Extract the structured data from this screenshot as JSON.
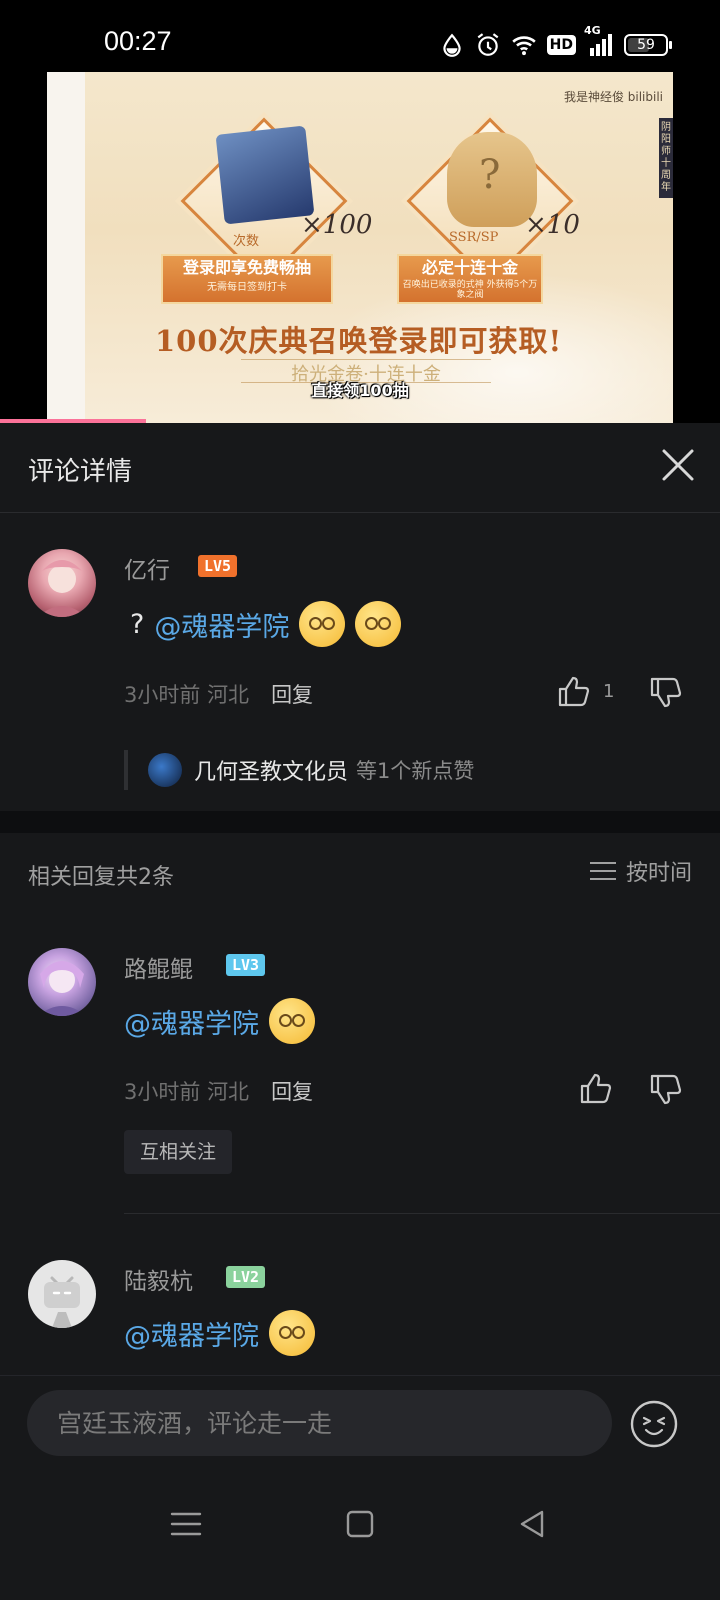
{
  "status_bar": {
    "time": "00:27",
    "hd": "HD",
    "network": "4G",
    "battery": "59",
    "battery_level": 0.59
  },
  "video": {
    "watermark": "我是神经俊 bilibili",
    "item1_label": "次数",
    "item1_multiplier": "×100",
    "item1_title": "登录即享免费畅抽",
    "item1_sub": "无需每日签到打卡",
    "item2_label": "SSR/SP",
    "item2_multiplier": "×10",
    "item2_title": "必定十连十金",
    "item2_sub": "召唤出已收录的式神 外获得5个万象之阀",
    "headline": "100次庆典召唤登录即可获取!",
    "subline": "拾光金卷·十连十金",
    "subtitle": "直接领100抽",
    "side_text": "阴阳师十周年"
  },
  "panel": {
    "title": "评论详情"
  },
  "main_comment": {
    "username": "亿行",
    "level": "LV5",
    "level_color": "#f0712c",
    "prefix": "?",
    "mention": "@魂器学院",
    "time": "3小时前",
    "location": "河北",
    "reply_label": "回复",
    "like_count": "1",
    "liked_by_name": "几何圣教文化员",
    "liked_by_rest": "等1个新点赞"
  },
  "replies": {
    "header": "相关回复共2条",
    "sort_label": "按时间",
    "items": [
      {
        "username": "路鲲鲲",
        "level": "LV3",
        "level_color": "#5ec7ee",
        "mention": "@魂器学院",
        "time": "3小时前",
        "location": "河北",
        "reply_label": "回复",
        "tag": "互相关注"
      },
      {
        "username": "陆毅杭",
        "level": "LV2",
        "level_color": "#8bd29d",
        "mention": "@魂器学院"
      }
    ]
  },
  "input": {
    "placeholder": "宫廷玉液酒，评论走一走"
  }
}
